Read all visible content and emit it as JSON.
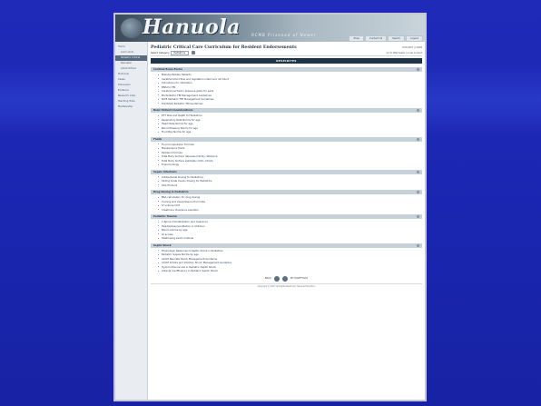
{
  "site": {
    "logo": "Hanuola",
    "tagline": "RCMB Prisoned of Newer",
    "top_nav": [
      "Shop",
      "Contact Us",
      "Search",
      "Logout"
    ]
  },
  "sidebar": {
    "items": [
      {
        "label": "Home",
        "active": false,
        "sub": false
      },
      {
        "label": "Curriculum",
        "active": false,
        "sub": true
      },
      {
        "label": "Pediatric Critical",
        "active": true,
        "sub": true
      },
      {
        "label": "Neonatal",
        "active": false,
        "sub": true
      },
      {
        "label": "Adult Critical",
        "active": false,
        "sub": true
      },
      {
        "label": "Protocols",
        "active": false,
        "sub": false
      },
      {
        "label": "Cases",
        "active": false,
        "sub": false
      },
      {
        "label": "Discussion",
        "active": false,
        "sub": false
      },
      {
        "label": "Evidence",
        "active": false,
        "sub": false
      },
      {
        "label": "Research Links",
        "active": false,
        "sub": false
      },
      {
        "label": "Teaching Tools",
        "active": false,
        "sub": false
      },
      {
        "label": "Membership",
        "active": false,
        "sub": false
      }
    ]
  },
  "page": {
    "title": "Pediatric Critical Care Curriculum for Resident Endorsements",
    "meta_right": "3/21/2007 | LOGIN",
    "filter_label": "Select Category",
    "filter_value": "Pediatrics",
    "filter_right": "Go to Webmaster  Locale Contact",
    "header": "RESPIRITES"
  },
  "sections": [
    {
      "title": "Cardinal Exam Forms",
      "items": [
        "Massive Bobbie Hazards",
        "Cerebral blood flow and regulation intact and not blunt",
        "Indications for intubation",
        "BNS for TBI",
        "Cerebral perfusion pressure goals for peds",
        "BA Pediatric TBI Management Guidelines",
        "NICE Pediatric TBI Management Guidelines",
        "Published Pediatric TBI Guidelines"
      ]
    },
    {
      "title": "Basic Patient Considerations",
      "items": [
        "ETT Size and Depth for Pediatrics",
        "Respiratory Rate Norms for age",
        "Heart Rate Norms for age",
        "Blood Pressure Norms for age",
        "Fluid Bps Norms for age"
      ]
    },
    {
      "title": "Fluids",
      "items": [
        "Fluid Composition Formula",
        "Maintenance fluids",
        "Parkland formula",
        "Total Body Surface (abscess) family reference",
        "Total Body Surface estimate (child, infant)",
        "Endocrinology"
      ]
    },
    {
      "title": "Sepsis Infections",
      "items": [
        "Antibacterial Dosing for Pediatrics",
        "Sliding Scale Insulin Dosing for Pediatrics",
        "DKA Protocol"
      ]
    },
    {
      "title": "Drug Dosing in Pediatrics",
      "items": [
        "BSA calculation for drug dosing",
        "Cooling and vasopressors from labs",
        "IV volume limit",
        "Creatinine Clearance equation"
      ]
    },
    {
      "title": "Pediatric Trauma",
      "items": [
        "C-Spine immobilization and clearance",
        "Head/airway/ventilation in Children",
        "Blood volume by age",
        "GI access",
        "Swallowing exam routines"
      ]
    },
    {
      "title": "Septic Shock",
      "items": [
        "Physiologic Response to Septic Shock in Pediatrics",
        "Pediatric Sepsis Norms by age",
        "ACCM Neonate Shock Management Guideline",
        "ACCM Infants and Children Shock Management Guideline",
        "Hydrocortisone use in Pediatric Septic Shock",
        "Adrenal Insufficiency in Pediatric Septic Shock"
      ]
    }
  ],
  "footer": {
    "back_label": "BACK",
    "top_label": "MY PORTFOLIO",
    "copyright": "Copyright © 2007 All Rights Reserved, Hanuola Education"
  }
}
